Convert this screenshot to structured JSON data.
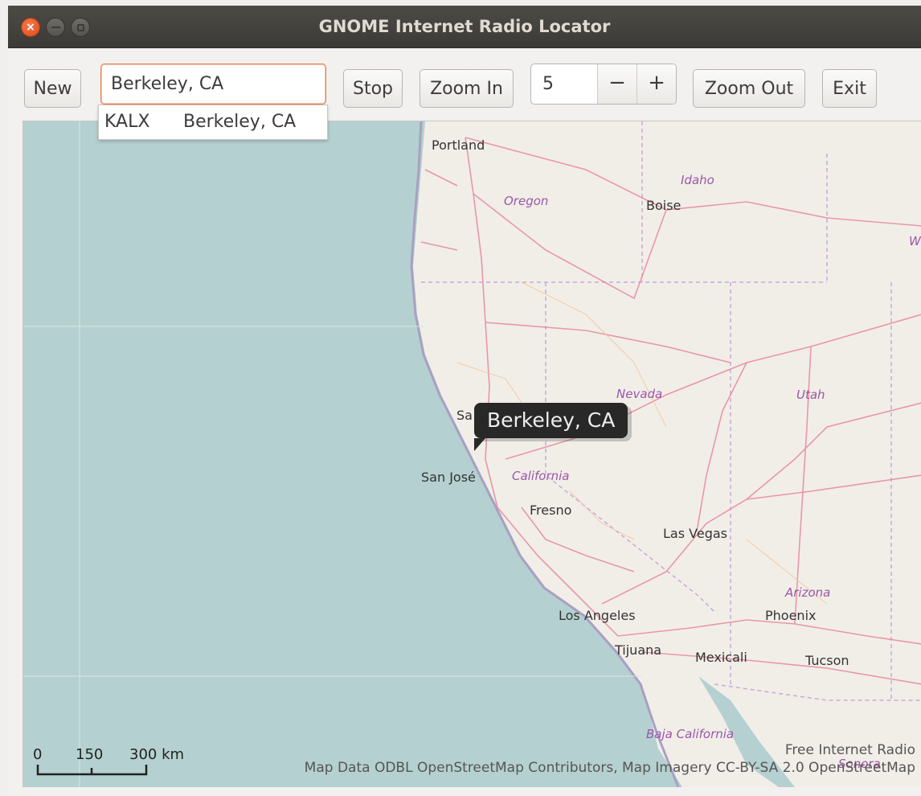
{
  "window": {
    "title": "GNOME Internet Radio Locator"
  },
  "toolbar": {
    "new_label": "New",
    "search_value": "Berkeley, CA",
    "stop_label": "Stop",
    "zoom_in_label": "Zoom In",
    "zoom_level": "5",
    "zoom_out_label": "Zoom Out",
    "exit_label": "Exit"
  },
  "completion": {
    "station": "KALX",
    "location": "Berkeley, CA"
  },
  "map": {
    "marker_label": "Berkeley, CA",
    "place_labels": {
      "portland": "Portland",
      "boise": "Boise",
      "san_francisco_partial": "Sa",
      "san_jose": "San José",
      "fresno": "Fresno",
      "las_vegas": "Las Vegas",
      "los_angeles": "Los Angeles",
      "tijuana": "Tijuana",
      "mexicali": "Mexicali",
      "phoenix": "Phoenix",
      "tucson": "Tucson"
    },
    "state_labels": {
      "idaho": "Idaho",
      "oregon": "Oregon",
      "nevada": "Nevada",
      "utah": "Utah",
      "california": "California",
      "arizona": "Arizona",
      "baja_california": "Baja California",
      "wyoming_partial": "W",
      "sonora_partial": "Sonora"
    },
    "scale": {
      "t0": "0",
      "t1": "150",
      "t2": "300 km"
    },
    "credit_line1": "Free Internet Radio",
    "credit_line2": "Map Data ODBL OpenStreetMap Contributors, Map Imagery CC-BY-SA 2.0 OpenStreetMap"
  }
}
